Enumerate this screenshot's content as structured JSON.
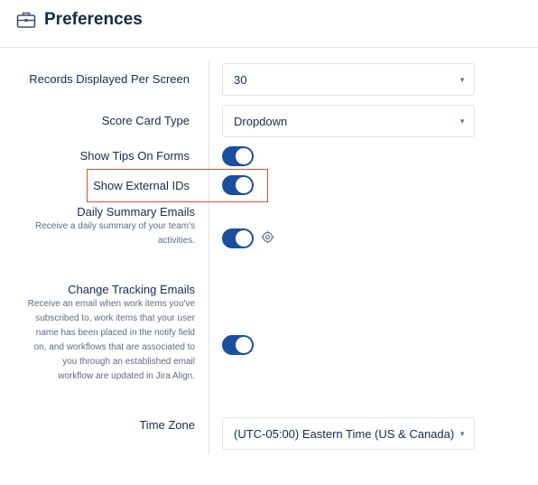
{
  "header": {
    "title": "Preferences",
    "icon": "briefcase-icon"
  },
  "records_per_screen": {
    "label": "Records Displayed Per Screen",
    "value": "30"
  },
  "score_card_type": {
    "label": "Score Card Type",
    "value": "Dropdown"
  },
  "show_tips": {
    "label": "Show Tips On Forms",
    "enabled": true
  },
  "show_external_ids": {
    "label": "Show External IDs",
    "enabled": true,
    "highlight_color": "#e0502b"
  },
  "daily_summary": {
    "label": "Daily Summary Emails",
    "desc_lines": [
      "Receive a daily summary of your team's",
      "activities."
    ],
    "enabled": true,
    "extra_icon": "target-icon"
  },
  "change_tracking": {
    "label": "Change Tracking Emails",
    "desc_lines": [
      "Receive an email when work items you've",
      "subscribed to, work items that your user",
      "name has been placed in the notify field",
      "on, and workflows that are associated to",
      "you through an established email",
      "workflow are updated in Jira Align."
    ],
    "enabled": true
  },
  "time_zone": {
    "label": "Time Zone",
    "value": "(UTC-05:00) Eastern Time (US & Canada)"
  },
  "colors": {
    "toggle_on": "#1a4fa0",
    "title": "#172b4d",
    "description": "#5e6c84"
  }
}
